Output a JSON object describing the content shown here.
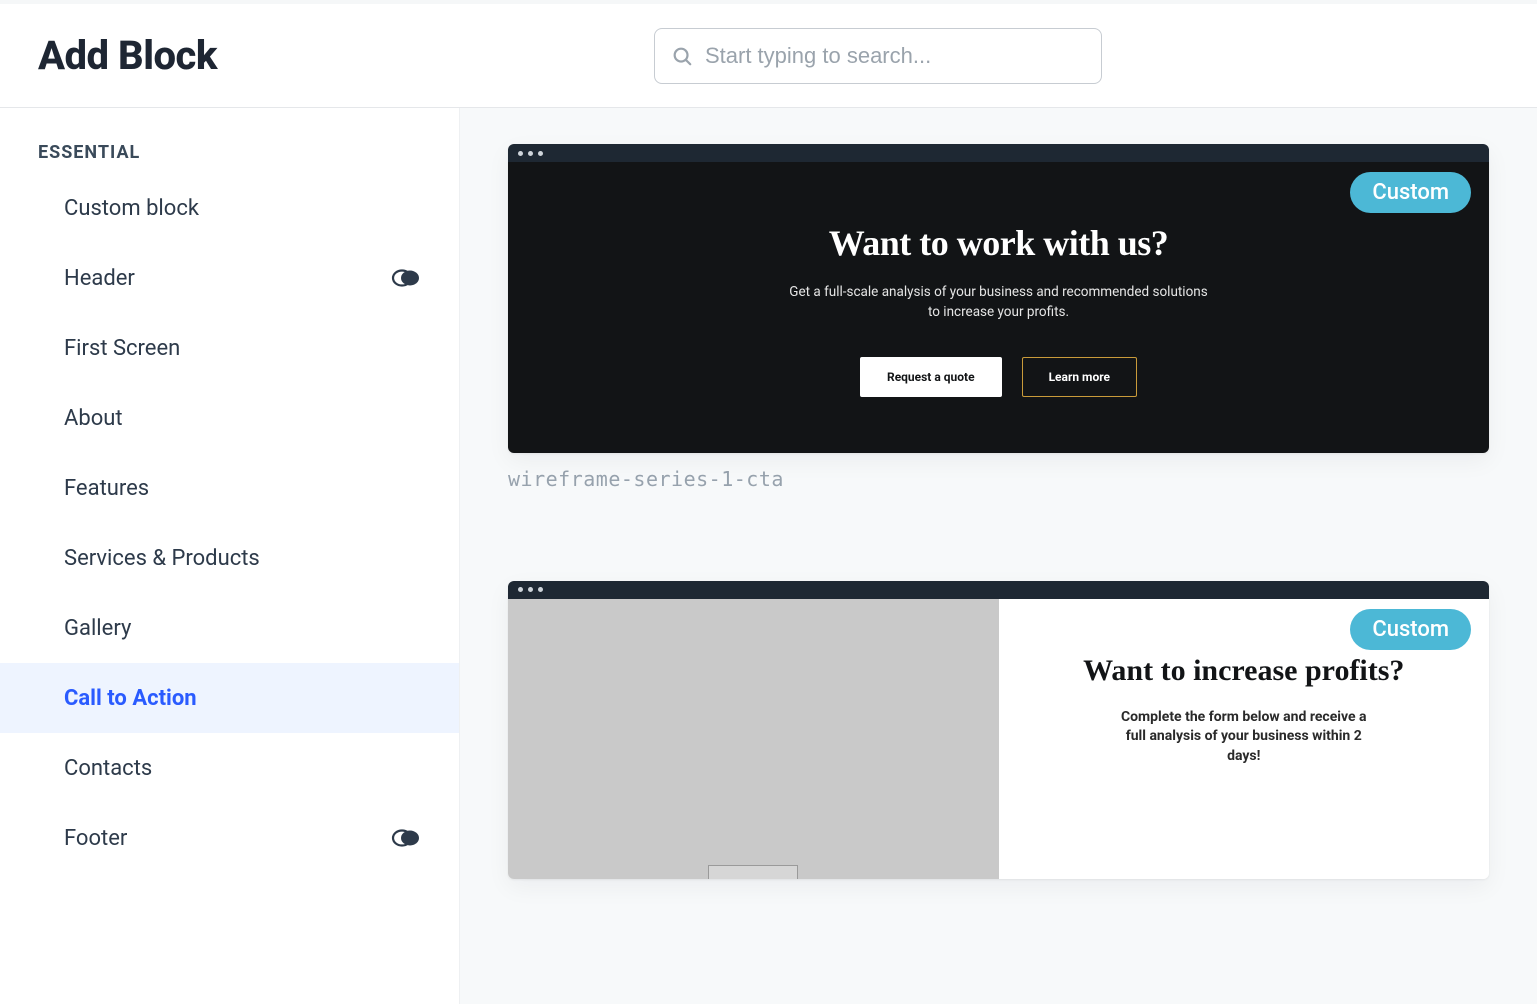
{
  "header": {
    "title": "Add Block",
    "search_placeholder": "Start typing to search..."
  },
  "sidebar": {
    "section_label": "ESSENTIAL",
    "items": [
      {
        "label": "Custom block",
        "has_toggle": false,
        "active": false
      },
      {
        "label": "Header",
        "has_toggle": true,
        "active": false
      },
      {
        "label": "First Screen",
        "has_toggle": false,
        "active": false
      },
      {
        "label": "About",
        "has_toggle": false,
        "active": false
      },
      {
        "label": "Features",
        "has_toggle": false,
        "active": false
      },
      {
        "label": "Services & Products",
        "has_toggle": false,
        "active": false
      },
      {
        "label": "Gallery",
        "has_toggle": false,
        "active": false
      },
      {
        "label": "Call to Action",
        "has_toggle": false,
        "active": true
      },
      {
        "label": "Contacts",
        "has_toggle": false,
        "active": false
      },
      {
        "label": "Footer",
        "has_toggle": true,
        "active": false
      }
    ]
  },
  "previews": {
    "card1": {
      "badge": "Custom",
      "heading": "Want to work with us?",
      "subtext": "Get a full-scale analysis of your business and recommended solutions to increase your profits.",
      "btn_primary": "Request a quote",
      "btn_secondary": "Learn more",
      "caption": "wireframe-series-1-cta"
    },
    "card2": {
      "badge": "Custom",
      "heading": "Want to increase profits?",
      "subtext": "Complete the form below and receive a full analysis of your business within 2 days!"
    }
  }
}
